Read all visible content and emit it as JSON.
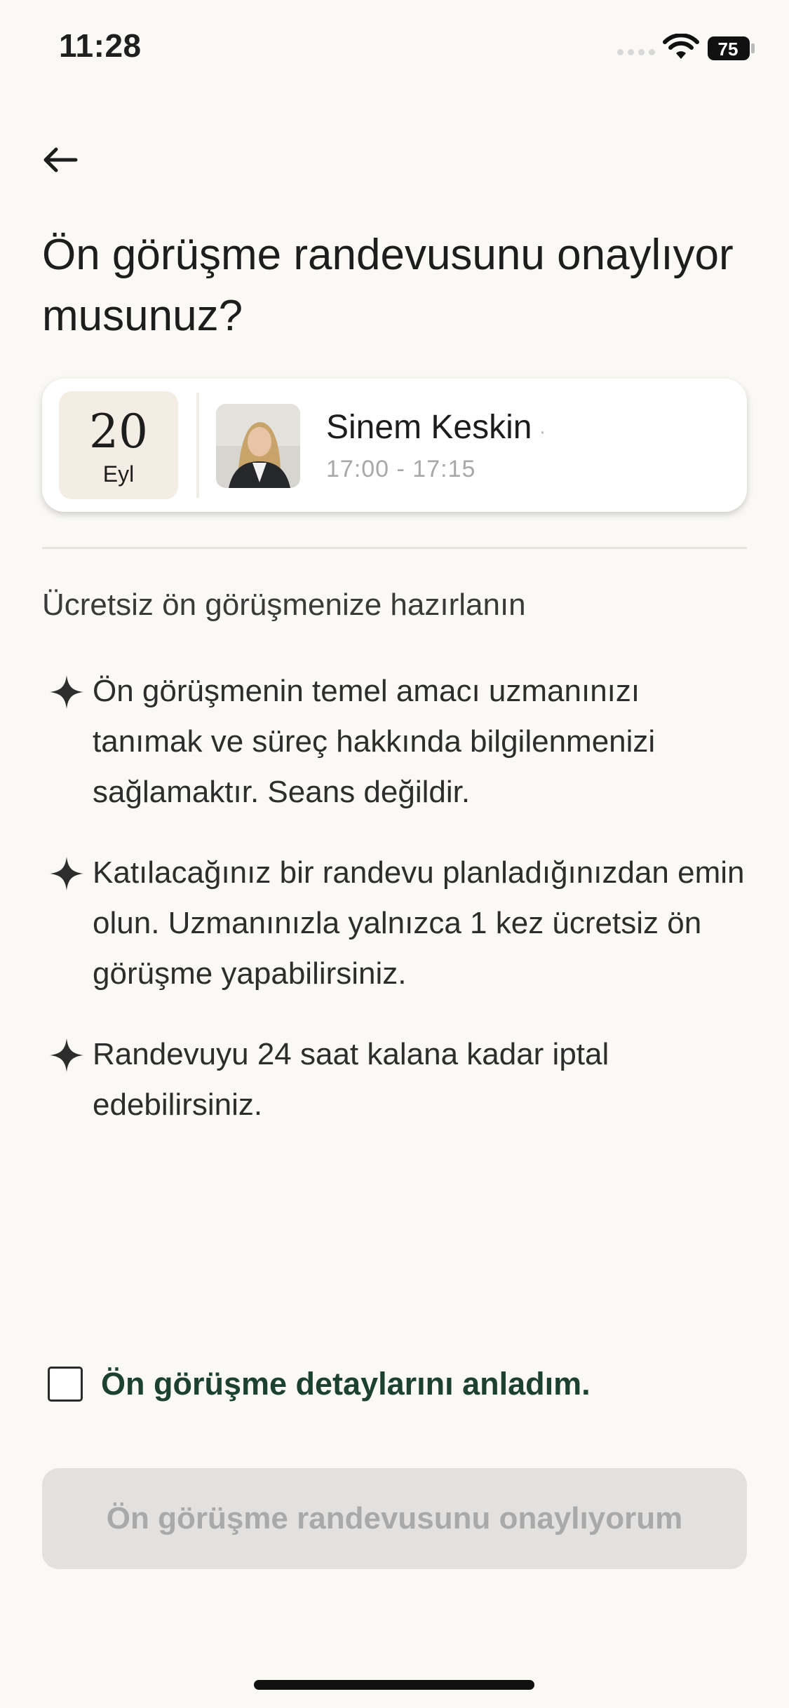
{
  "status_bar": {
    "time": "11:28",
    "battery": "75"
  },
  "title": "Ön görüşme randevusunu onaylıyor musunuz?",
  "appointment": {
    "day": "20",
    "month": "Eyl",
    "name": "Sinem Keskin",
    "dot": "·",
    "time_range": "17:00 - 17:15"
  },
  "prep": {
    "heading": "Ücretsiz ön görüşmenize hazırlanın",
    "items": [
      "Ön görüşmenin temel amacı uzmanınızı tanımak ve süreç hakkında bilgilenmenizi sağlamaktır. Seans değildir.",
      "Katılacağınız bir randevu planladığınızdan emin olun. Uzmanınızla yalnızca 1 kez ücretsiz ön görüşme yapabilirsiniz.",
      "Randevuyu 24 saat kalana kadar iptal edebilirsiniz."
    ]
  },
  "agreement": {
    "label": "Ön görüşme detaylarını anladım.",
    "checked": false
  },
  "confirm_button": {
    "label": "Ön görüşme randevusunu onaylıyorum",
    "enabled": false
  },
  "colors": {
    "background": "#faf9f5",
    "accent_green": "#1c4133",
    "date_tile": "#f4ede3",
    "disabled_button": "#e2e1df"
  },
  "icons": {
    "back": "arrow-left-icon",
    "bullet": "sparkle-icon",
    "wifi": "wifi-icon",
    "battery": "battery-icon"
  }
}
